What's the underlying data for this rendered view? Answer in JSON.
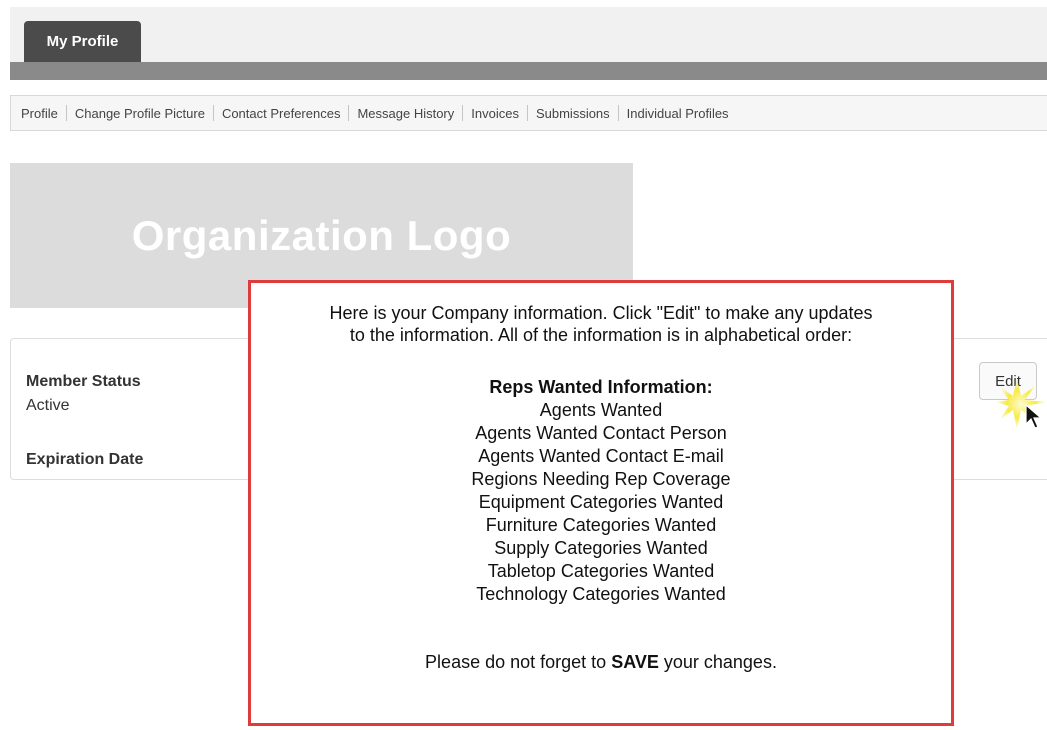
{
  "header": {
    "tab_label": "My Profile"
  },
  "subnav": {
    "items": [
      "Profile",
      "Change Profile Picture",
      "Contact Preferences",
      "Message History",
      "Invoices",
      "Submissions",
      "Individual Profiles"
    ]
  },
  "logo": {
    "text": "Organization Logo"
  },
  "profile": {
    "member_status_label": "Member Status",
    "member_status_value": "Active",
    "expiration_label": "Expiration Date",
    "edit_label": "Edit"
  },
  "callout": {
    "intro_line1": "Here is your Company information. Click \"Edit\" to make any updates",
    "intro_line2": "to the information. All of the information is in alphabetical order:",
    "heading": "Reps Wanted Information:",
    "items": [
      "Agents Wanted",
      "Agents Wanted Contact Person",
      "Agents Wanted Contact E-mail",
      "Regions Needing Rep Coverage",
      "Equipment Categories Wanted",
      "Furniture Categories Wanted",
      "Supply Categories Wanted",
      "Tabletop Categories Wanted",
      "Technology Categories Wanted"
    ],
    "save_prefix": "Please do not forget to ",
    "save_word": "SAVE",
    "save_suffix": " your changes."
  },
  "colors": {
    "tab_bg": "#4b4b4b",
    "bar": "#8a8a8a",
    "logo_bg": "#dcdcdc",
    "callout_border": "#e03b3b"
  },
  "icons": [
    "mouse-pointer-icon",
    "click-burst-icon"
  ]
}
